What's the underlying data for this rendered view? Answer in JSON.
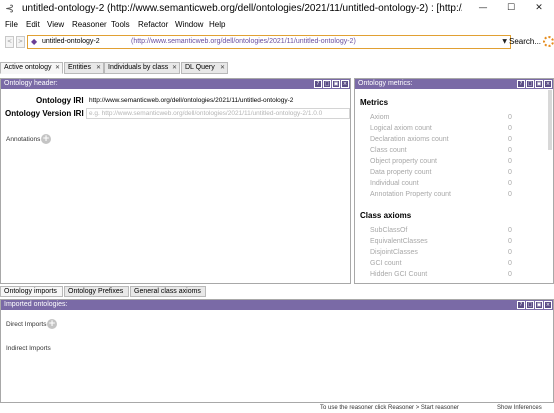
{
  "window": {
    "title": "untitled-ontology-2 (http://www.semanticweb.org/dell/ontologies/2021/11/untitled-ontology-2)  : [http://...",
    "controls": {
      "minimize": "—",
      "maximize": "☐",
      "close": "✕"
    }
  },
  "menu": {
    "items": [
      "File",
      "Edit",
      "View",
      "Reasoner",
      "Tools",
      "Refactor",
      "Window",
      "Help"
    ]
  },
  "address": {
    "back": "<",
    "forward": ">",
    "ontology_name": "untitled-ontology-2",
    "ontology_url": "(http://www.semanticweb.org/dell/ontologies/2021/11/untitled-ontology-2)",
    "search_label": "Search..."
  },
  "tabs": [
    {
      "label": "Active ontology"
    },
    {
      "label": "Entities"
    },
    {
      "label": "Individuals by class"
    },
    {
      "label": "DL Query"
    }
  ],
  "ontology_header": {
    "title": "Ontology header:",
    "iri_label": "Ontology IRI",
    "iri_value": "http://www.semanticweb.org/dell/ontologies/2021/11/untitled-ontology-2",
    "version_label": "Ontology Version IRI",
    "version_placeholder": "e.g. http://www.semanticweb.org/dell/ontologies/2021/11/untitled-ontology-2/1.0.0",
    "annotations_label": "Annotations"
  },
  "metrics": {
    "title": "Ontology metrics:",
    "section_metrics": "Metrics",
    "rows": [
      {
        "label": "Axiom",
        "value": "0"
      },
      {
        "label": "Logical axiom count",
        "value": "0"
      },
      {
        "label": "Declaration axioms count",
        "value": "0"
      },
      {
        "label": "Class count",
        "value": "0"
      },
      {
        "label": "Object property count",
        "value": "0"
      },
      {
        "label": "Data property count",
        "value": "0"
      },
      {
        "label": "Individual count",
        "value": "0"
      },
      {
        "label": "Annotation Property count",
        "value": "0"
      }
    ],
    "section_class_axioms": "Class axioms",
    "class_rows": [
      {
        "label": "SubClassOf",
        "value": "0"
      },
      {
        "label": "EquivalentClasses",
        "value": "0"
      },
      {
        "label": "DisjointClasses",
        "value": "0"
      },
      {
        "label": "GCI count",
        "value": "0"
      },
      {
        "label": "Hidden GCI Count",
        "value": "0"
      }
    ]
  },
  "bottom_tabs": [
    {
      "label": "Ontology imports"
    },
    {
      "label": "Ontology Prefixes"
    },
    {
      "label": "General class axioms"
    }
  ],
  "imports": {
    "title": "Imported ontologies:",
    "direct_label": "Direct Imports",
    "indirect_label": "Indirect Imports"
  },
  "status": {
    "fragments": [
      "To use the reasoner click Reasoner > Start reasoner",
      "Show Inferences"
    ]
  }
}
